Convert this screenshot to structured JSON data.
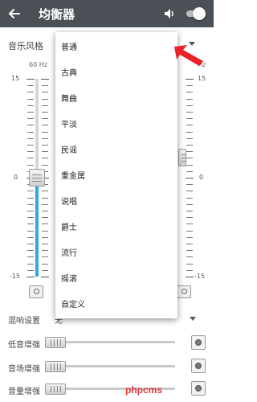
{
  "header": {
    "title": "均衡器",
    "background": "#4a5055",
    "toggle_on": false
  },
  "preset": {
    "label": "音乐风格"
  },
  "eq": {
    "freq_labels": [
      "60 Hz",
      "Hz"
    ],
    "db_top": "15",
    "db_mid": "0",
    "db_bottom": "-15",
    "db_top_right": "15",
    "db_mid_right": "0",
    "db_bottom_right": "-15",
    "bands": [
      {
        "freq": "60 Hz",
        "gain_db": 0
      }
    ],
    "accent": "#2eaae0"
  },
  "dropdown": {
    "items": [
      "普通",
      "古典",
      "舞曲",
      "平淡",
      "民谣",
      "重金属",
      "说唱",
      "爵士",
      "流行",
      "摇滚",
      "自定义"
    ]
  },
  "effects": {
    "reverb_label": "混响设置",
    "reverb_value": "无",
    "bass_label": "低音增强",
    "surround_label": "音场增强",
    "loudness_label": "音量增强",
    "bass_level": 0,
    "surround_level": 0,
    "loudness_level": 0
  },
  "watermark": "phpcms"
}
